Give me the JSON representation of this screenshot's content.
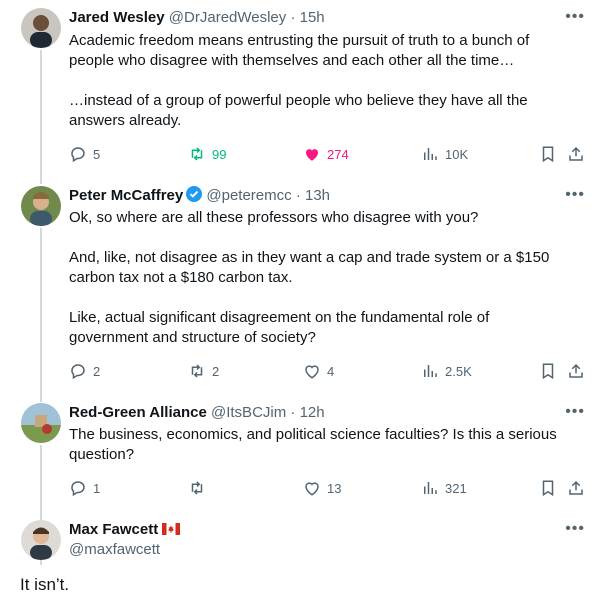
{
  "tweets": [
    {
      "name": "Jared Wesley",
      "handle": "@DrJaredWesley",
      "time": "15h",
      "body": [
        "Academic freedom means entrusting the pursuit of truth to a bunch of people who disagree with themselves and each other all the time…",
        "…instead of a group of powerful people who believe they have all the answers already."
      ],
      "replies": "5",
      "retweets": "99",
      "likes": "274",
      "views": "10K"
    },
    {
      "name": "Peter McCaffrey",
      "handle": "@peteremcc",
      "time": "13h",
      "body": [
        "Ok, so where are all these professors who disagree with you?",
        "And, like, not disagree as in they want a cap and trade system or a $150 carbon tax not a $180 carbon tax.",
        "Like, actual significant  disagreement on the fundamental role of government and structure of society?"
      ],
      "replies": "2",
      "retweets": "2",
      "likes": "4",
      "views": "2.5K"
    },
    {
      "name": "Red-Green Alliance",
      "handle": "@ItsBCJim",
      "time": "12h",
      "body": [
        "The business, economics, and political science faculties? Is this a serious question?"
      ],
      "replies": "1",
      "retweets": "",
      "likes": "13",
      "views": "321"
    },
    {
      "name": "Max Fawcett",
      "handle": "@maxfawcett",
      "body": [
        "It isn’t."
      ]
    }
  ],
  "separator": "·",
  "more_glyph": "•••",
  "colors": {
    "retweet_active": "#00ba7c",
    "like_active": "#f91880",
    "verified": "#1d9bf0",
    "thread_line": "#cfd9de"
  }
}
